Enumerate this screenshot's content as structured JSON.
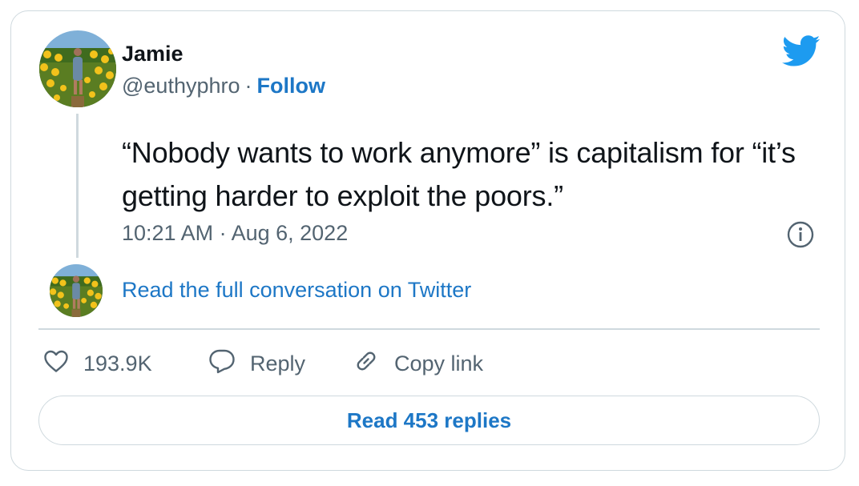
{
  "author": {
    "name": "Jamie",
    "handle": "@euthyphro",
    "separator": "·",
    "follow_label": "Follow"
  },
  "tweet": {
    "text": "“Nobody wants to work anymore” is capitalism for “it’s getting harder to exploit the poors.”",
    "timestamp": "10:21 AM · Aug 6, 2022"
  },
  "conversation_link": "Read the full conversation on Twitter",
  "actions": {
    "like_count": "193.9K",
    "reply_label": "Reply",
    "copy_link_label": "Copy link"
  },
  "replies_button": "Read 453 replies",
  "icons": {
    "brand": "twitter-bird-icon",
    "info": "info-icon",
    "like": "heart-icon",
    "reply": "speech-bubble-icon",
    "copy": "link-icon"
  },
  "colors": {
    "accent": "#1d77c6",
    "twitter_blue": "#1d9bf0",
    "muted_text": "#536471",
    "border": "#cfd9de"
  }
}
